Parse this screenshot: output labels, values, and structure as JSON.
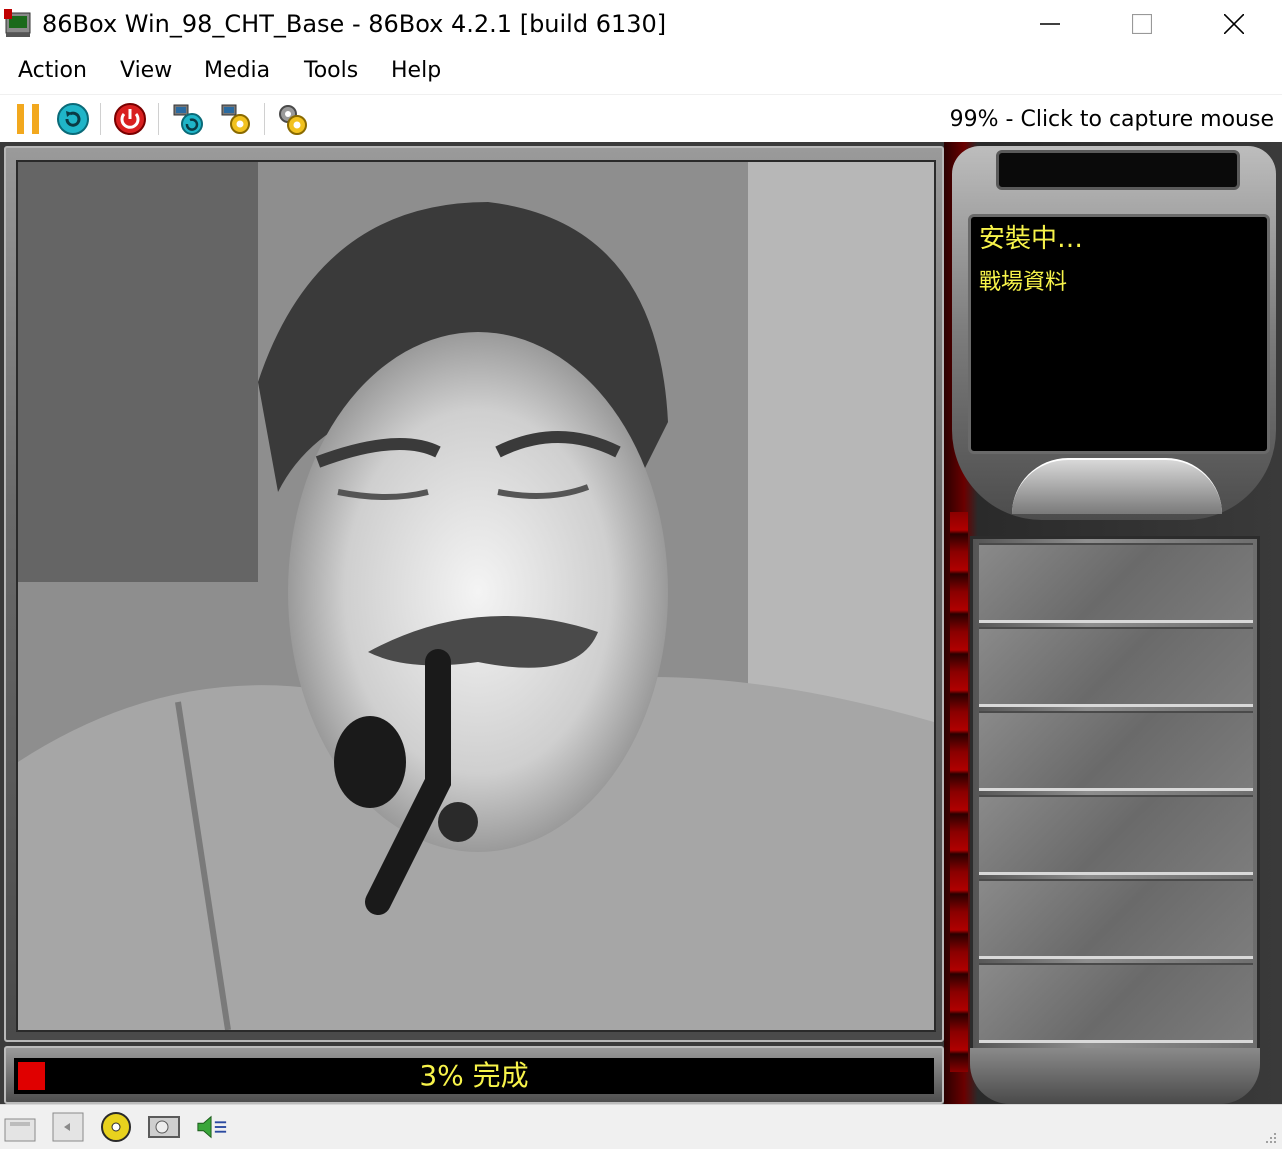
{
  "window": {
    "title": "86Box Win_98_CHT_Base - 86Box 4.2.1 [build 6130]",
    "icon": "86box-app-icon",
    "controls": [
      "minimize-icon",
      "maximize-icon",
      "close-icon"
    ]
  },
  "menu": {
    "items": [
      {
        "label": "Action"
      },
      {
        "label": "View"
      },
      {
        "label": "Media"
      },
      {
        "label": "Tools"
      },
      {
        "label": "Help"
      }
    ]
  },
  "toolbar": {
    "buttons": [
      {
        "icon": "pause-icon"
      },
      {
        "icon": "ctrl-alt-del-icon"
      },
      {
        "icon": "power-icon"
      },
      {
        "icon": "hard-reset-icon"
      },
      {
        "icon": "machine-settings-icon"
      },
      {
        "icon": "global-settings-icon"
      }
    ],
    "status": "99% - Click to capture mouse"
  },
  "game": {
    "radar_line1": "安裝中…",
    "radar_line2": "戰場資料",
    "progress_label": "3% 完成",
    "progress_percent": 3,
    "colors": {
      "text": "#f7f34a",
      "progress_fill": "#e00000"
    }
  },
  "statusbar": {
    "icons": [
      "floppy-drive-icon",
      "floppy-drive-2-icon",
      "cdrom-icon",
      "hard-disk-icon",
      "sound-icon",
      "resize-grip-icon"
    ]
  }
}
